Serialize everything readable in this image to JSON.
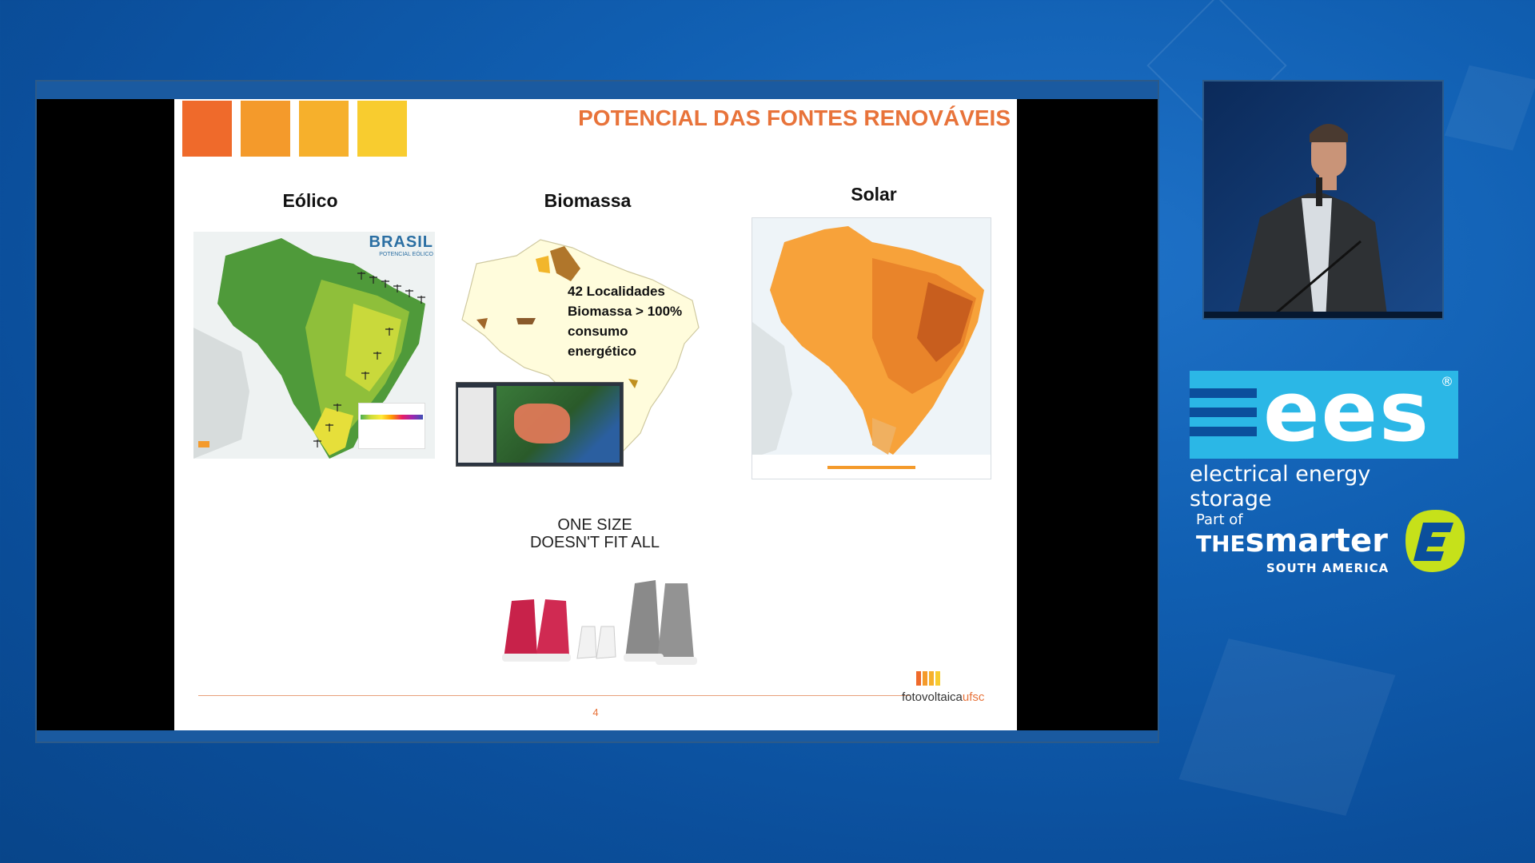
{
  "slide": {
    "title": "POTENCIAL DAS FONTES RENOVÁVEIS",
    "squares": [
      "#ef6a2b",
      "#f49a2b",
      "#f6b02c",
      "#f8cc2f"
    ],
    "sections": {
      "eolico": {
        "label": "Eólico",
        "map_heading": "BRASIL",
        "map_subheading": "POTENCIAL EÓLICO"
      },
      "biomassa": {
        "label": "Biomassa",
        "annotation_lines": [
          "42 Localidades",
          "Biomassa > 100%",
          "consumo",
          "energético"
        ]
      },
      "solar": {
        "label": "Solar"
      }
    },
    "shoes_caption": [
      "ONE SIZE",
      "DOESN'T FIT ALL"
    ],
    "page_number": "4",
    "logo": {
      "text_main": "fotovoltaica",
      "text_accent": "ufsc",
      "bar_colors": [
        "#ef6a2b",
        "#f49a2b",
        "#f6b02c",
        "#f8cc2f"
      ]
    }
  },
  "branding": {
    "ees_letters": "ees",
    "registered": "®",
    "tagline": "electrical energy storage",
    "part_of": "Part of",
    "thesmarter_the": "THE",
    "thesmarter_main": "smarter",
    "region": "SOUTH AMERICA",
    "accent_color": "#2bb7e6",
    "e_badge_color": "#c6e11a"
  },
  "icons": {
    "speaker_video": "speaker-video-feed",
    "windmill": "windmill-icon"
  }
}
